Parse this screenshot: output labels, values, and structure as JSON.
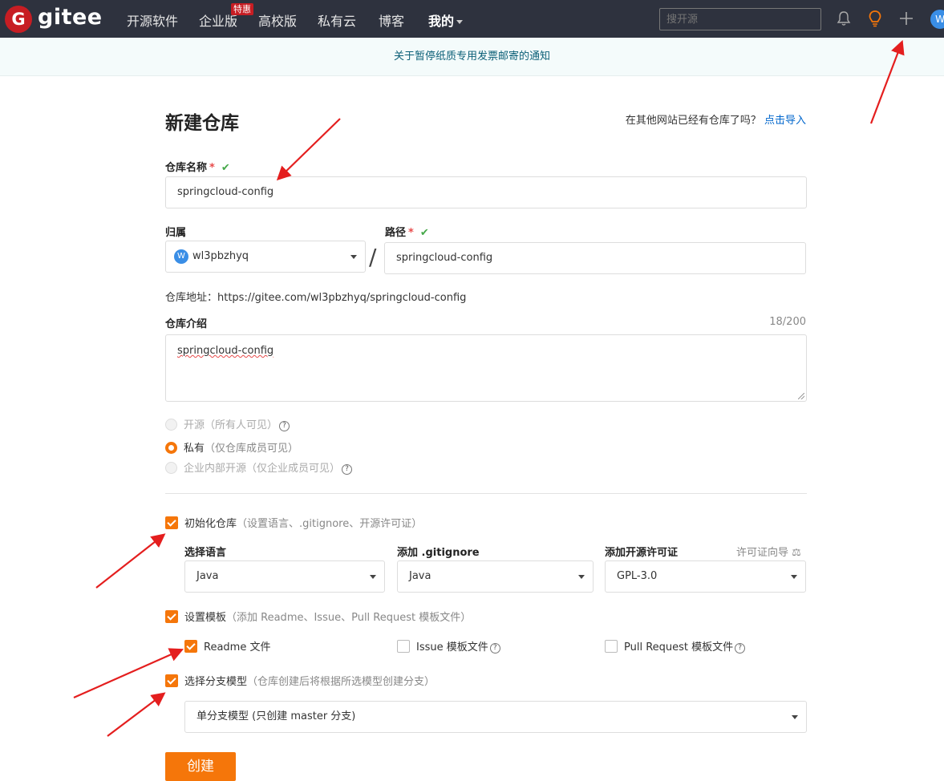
{
  "nav": {
    "logo_letter": "G",
    "logo_text": "gitee",
    "items": [
      "开源软件",
      "企业版",
      "高校版",
      "私有云",
      "博客",
      "我的"
    ],
    "promo_badge": "特惠",
    "search_placeholder": "搜开源",
    "avatar_letter": "W",
    "icons": [
      "bell-icon",
      "bulb-icon",
      "plus-icon"
    ]
  },
  "notice": "关于暂停纸质专用发票邮寄的通知",
  "form": {
    "title": "新建仓库",
    "import_prompt": "在其他网站已经有仓库了吗？",
    "import_link": "点击导入",
    "name_label": "仓库名称",
    "required_mark": "*",
    "name_value": "springcloud-config",
    "owner_label": "归属",
    "owner_avatar": "W",
    "owner_value": "wl3pbzhyq",
    "slash": "/",
    "path_label": "路径",
    "path_value": "springcloud-config",
    "address": "仓库地址：https://gitee.com/wl3pbzhyq/springcloud-config",
    "desc_label": "仓库介绍",
    "desc_counter": "18/200",
    "desc_value": "springcloud-config",
    "visibility": {
      "public_label": "开源",
      "public_hint": "（所有人可见）",
      "private_label": "私有",
      "private_hint": "（仅仓库成员可见）",
      "enterprise_label": "企业内部开源",
      "enterprise_hint": "（仅企业成员可见）",
      "selected": "private"
    },
    "init": {
      "label": "初始化仓库",
      "hint": "（设置语言、.gitignore、开源许可证）",
      "checked": true,
      "lang_label": "选择语言",
      "lang_value": "Java",
      "gitignore_label": "添加 .gitignore",
      "gitignore_value": "Java",
      "license_label": "添加开源许可证",
      "license_guide": "许可证向导",
      "license_value": "GPL-3.0"
    },
    "template": {
      "label": "设置模板",
      "hint": "（添加 Readme、Issue、Pull Request 模板文件）",
      "checked": true,
      "readme_label": "Readme 文件",
      "readme_checked": true,
      "issue_label": "Issue 模板文件",
      "issue_checked": false,
      "pr_label": "Pull Request 模板文件",
      "pr_checked": false
    },
    "branch": {
      "label": "选择分支模型",
      "hint": "（仓库创建后将根据所选模型创建分支）",
      "checked": true,
      "value": "单分支模型 (只创建 master 分支)"
    },
    "submit_label": "创建"
  },
  "colors": {
    "nav_bg": "#2e323e",
    "brand_red": "#c71d23",
    "accent_orange": "#f5760a",
    "link_blue": "#0066cc",
    "annotation_red": "#e41e1e"
  }
}
